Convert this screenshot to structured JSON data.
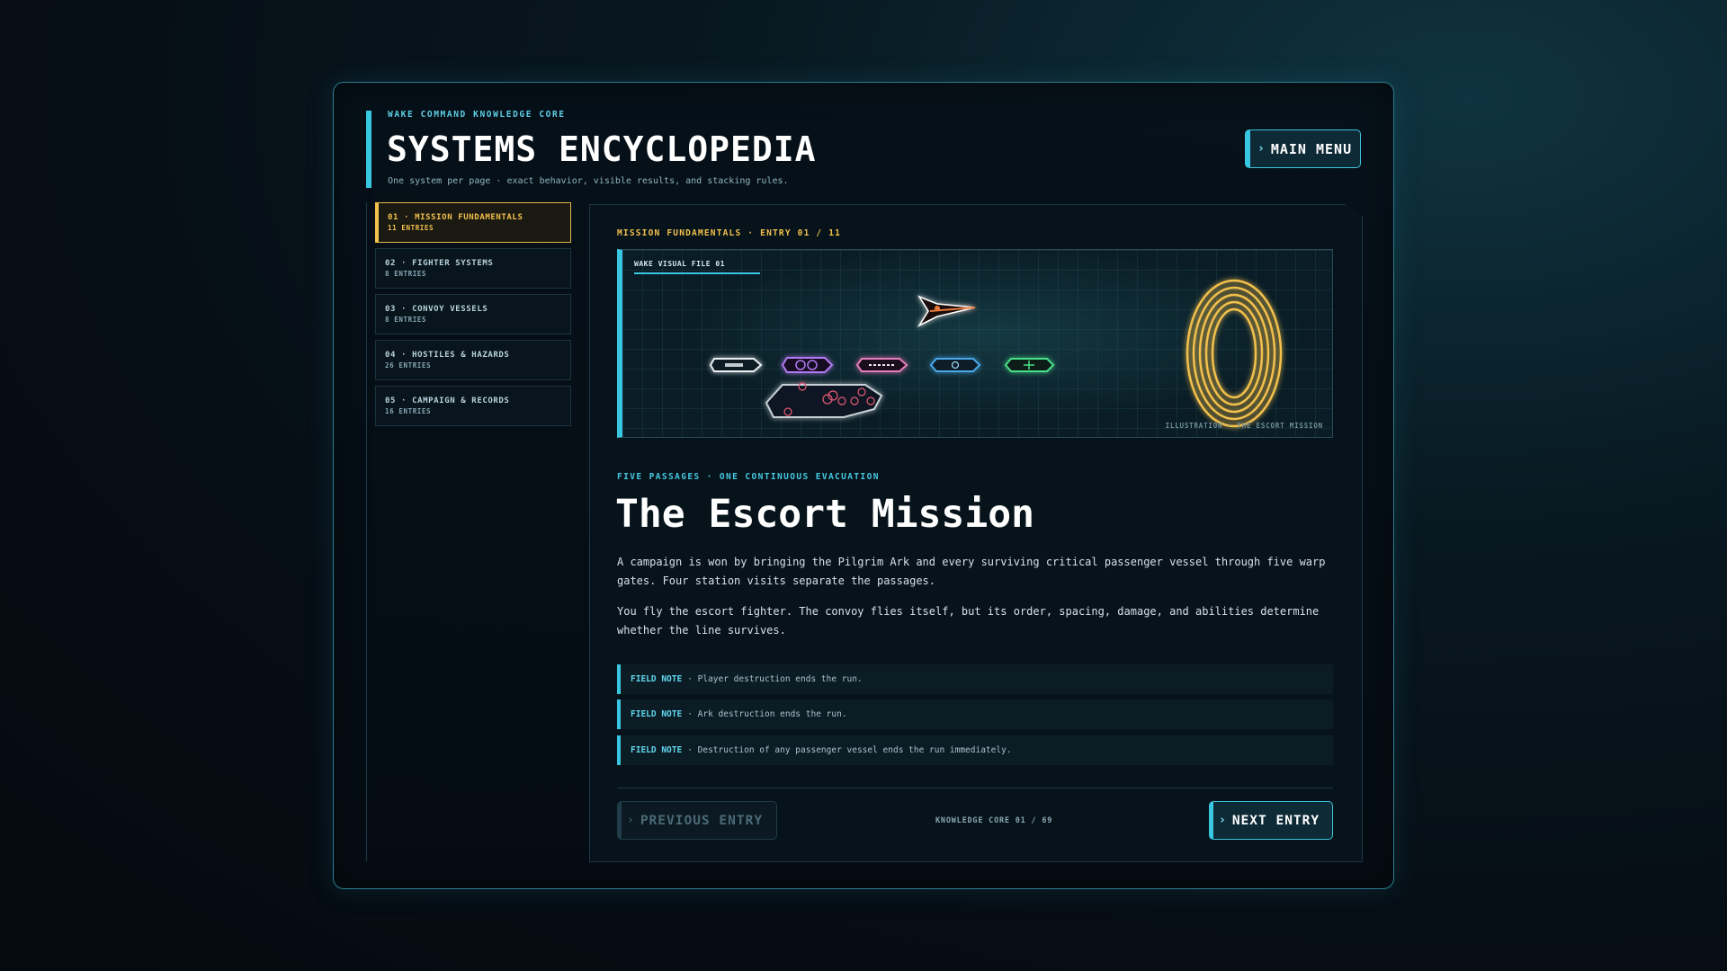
{
  "header": {
    "eyebrow": "WAKE COMMAND KNOWLEDGE CORE",
    "title": "SYSTEMS ENCYCLOPEDIA",
    "subtitle": "One system per page · exact behavior, visible results, and stacking rules.",
    "main_menu_label": "MAIN MENU"
  },
  "sidebar": {
    "items": [
      {
        "label": "01 · MISSION FUNDAMENTALS",
        "count": "11 ENTRIES",
        "active": true
      },
      {
        "label": "02 · FIGHTER SYSTEMS",
        "count": "8 ENTRIES",
        "active": false
      },
      {
        "label": "03 · CONVOY VESSELS",
        "count": "8 ENTRIES",
        "active": false
      },
      {
        "label": "04 · HOSTILES & HAZARDS",
        "count": "26 ENTRIES",
        "active": false
      },
      {
        "label": "05 · CAMPAIGN & RECORDS",
        "count": "16 ENTRIES",
        "active": false
      }
    ]
  },
  "entry": {
    "meta": "MISSION FUNDAMENTALS · ENTRY 01 / 11",
    "visual_label": "WAKE VISUAL FILE 01",
    "visual_caption": "ILLUSTRATION · THE ESCORT MISSION",
    "kicker": "FIVE PASSAGES · ONE CONTINUOUS EVACUATION",
    "title": "The Escort Mission",
    "paragraphs": [
      "A campaign is won by bringing the Pilgrim Ark and every surviving critical passenger vessel through five warp gates. Four station visits separate the passages.",
      "You fly the escort fighter. The convoy flies itself, but its order, spacing, damage, and abilities determine whether the line survives."
    ],
    "notes": [
      {
        "tag": "FIELD NOTE",
        "text": "· Player destruction ends the run."
      },
      {
        "tag": "FIELD NOTE",
        "text": "· Ark destruction ends the run."
      },
      {
        "tag": "FIELD NOTE",
        "text": "· Destruction of any passenger vessel ends the run immediately."
      }
    ]
  },
  "footer": {
    "prev_label": "PREVIOUS ENTRY",
    "counter": "KNOWLEDGE CORE 01 / 69",
    "next_label": "NEXT ENTRY"
  },
  "colors": {
    "accent": "#39c6e0",
    "active": "#f2c04c",
    "gate": "#f2c04c",
    "fighter": "#e87a3c",
    "route": "#5de0a0"
  },
  "icons": {
    "menu_chevron": "chevron-right-icon",
    "fighter": "fighter-ship-icon",
    "gate": "warp-gate-icon"
  }
}
